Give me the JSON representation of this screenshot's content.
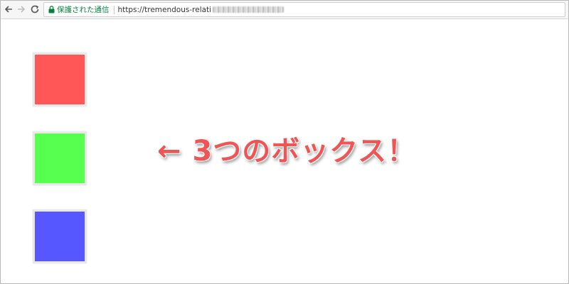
{
  "browser": {
    "secure_label": "保護された通信",
    "url": "https://tremendous-relati"
  },
  "page": {
    "caption": "← 3つのボックス！",
    "boxes": [
      {
        "color": "#ff5757"
      },
      {
        "color": "#57ff4f"
      },
      {
        "color": "#5757ff"
      }
    ]
  },
  "colors": {
    "caption": "#f05555",
    "secure": "#0b8043"
  }
}
